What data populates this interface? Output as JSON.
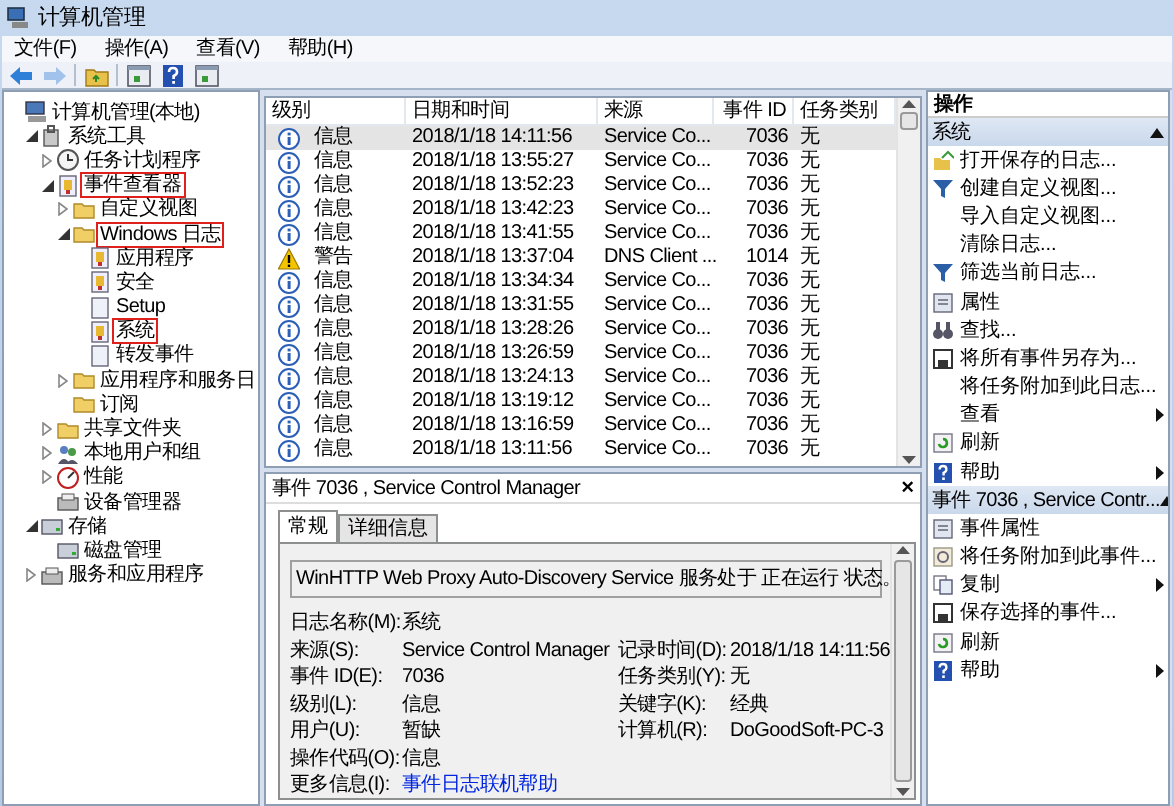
{
  "window": {
    "title": "计算机管理"
  },
  "menu": [
    "文件(F)",
    "操作(A)",
    "查看(V)",
    "帮助(H)"
  ],
  "toolbar": [
    {
      "kind": "back",
      "disabled": false
    },
    {
      "kind": "forward",
      "disabled": true
    },
    {
      "kind": "up",
      "disabled": false
    },
    {
      "kind": "panel",
      "disabled": false
    },
    {
      "kind": "help",
      "disabled": false
    },
    {
      "kind": "panel",
      "disabled": false
    }
  ],
  "tree": [
    {
      "label": "计算机管理(本地)",
      "kind": "computer",
      "children": [
        {
          "label": "系统工具",
          "kind": "tools",
          "expanded": true,
          "children": [
            {
              "label": "任务计划程序",
              "kind": "clock",
              "expanded": false
            },
            {
              "label": "事件查看器",
              "kind": "log",
              "expanded": true,
              "marked": true,
              "children": [
                {
                  "label": "自定义视图",
                  "kind": "folder",
                  "expanded": false
                },
                {
                  "label": "Windows 日志",
                  "kind": "folder",
                  "expanded": true,
                  "marked": true,
                  "children": [
                    {
                      "label": "应用程序",
                      "kind": "log"
                    },
                    {
                      "label": "安全",
                      "kind": "log"
                    },
                    {
                      "label": "Setup",
                      "kind": "page"
                    },
                    {
                      "label": "系统",
                      "kind": "log",
                      "marked": true
                    },
                    {
                      "label": "转发事件",
                      "kind": "page"
                    }
                  ]
                },
                {
                  "label": "应用程序和服务日",
                  "kind": "folder",
                  "expanded": false
                },
                {
                  "label": "订阅",
                  "kind": "folder"
                }
              ]
            },
            {
              "label": "共享文件夹",
              "kind": "folder",
              "expanded": false
            },
            {
              "label": "本地用户和组",
              "kind": "users",
              "expanded": false
            },
            {
              "label": "性能",
              "kind": "gauge",
              "expanded": false
            },
            {
              "label": "设备管理器",
              "kind": "device"
            }
          ]
        },
        {
          "label": "存储",
          "kind": "drive",
          "expanded": true,
          "children": [
            {
              "label": "磁盘管理",
              "kind": "drive"
            }
          ]
        },
        {
          "label": "服务和应用程序",
          "kind": "device",
          "expanded": false
        }
      ]
    }
  ],
  "table": {
    "columns": [
      "级别",
      "日期和时间",
      "来源",
      "事件 ID",
      "任务类别"
    ],
    "rows": [
      {
        "kind": "info",
        "level": "信息",
        "date": "2018/1/18 14:11:56",
        "source": "Service Co...",
        "id": "7036",
        "category": "无",
        "selected": true
      },
      {
        "kind": "info",
        "level": "信息",
        "date": "2018/1/18 13:55:27",
        "source": "Service Co...",
        "id": "7036",
        "category": "无",
        "selected": false
      },
      {
        "kind": "info",
        "level": "信息",
        "date": "2018/1/18 13:52:23",
        "source": "Service Co...",
        "id": "7036",
        "category": "无",
        "selected": false
      },
      {
        "kind": "info",
        "level": "信息",
        "date": "2018/1/18 13:42:23",
        "source": "Service Co...",
        "id": "7036",
        "category": "无",
        "selected": false
      },
      {
        "kind": "info",
        "level": "信息",
        "date": "2018/1/18 13:41:55",
        "source": "Service Co...",
        "id": "7036",
        "category": "无",
        "selected": false
      },
      {
        "kind": "warning",
        "level": "警告",
        "date": "2018/1/18 13:37:04",
        "source": "DNS Client ...",
        "id": "1014",
        "category": "无",
        "selected": false
      },
      {
        "kind": "info",
        "level": "信息",
        "date": "2018/1/18 13:34:34",
        "source": "Service Co...",
        "id": "7036",
        "category": "无",
        "selected": false
      },
      {
        "kind": "info",
        "level": "信息",
        "date": "2018/1/18 13:31:55",
        "source": "Service Co...",
        "id": "7036",
        "category": "无",
        "selected": false
      },
      {
        "kind": "info",
        "level": "信息",
        "date": "2018/1/18 13:28:26",
        "source": "Service Co...",
        "id": "7036",
        "category": "无",
        "selected": false
      },
      {
        "kind": "info",
        "level": "信息",
        "date": "2018/1/18 13:26:59",
        "source": "Service Co...",
        "id": "7036",
        "category": "无",
        "selected": false
      },
      {
        "kind": "info",
        "level": "信息",
        "date": "2018/1/18 13:24:13",
        "source": "Service Co...",
        "id": "7036",
        "category": "无",
        "selected": false
      },
      {
        "kind": "info",
        "level": "信息",
        "date": "2018/1/18 13:19:12",
        "source": "Service Co...",
        "id": "7036",
        "category": "无",
        "selected": false
      },
      {
        "kind": "info",
        "level": "信息",
        "date": "2018/1/18 13:16:59",
        "source": "Service Co...",
        "id": "7036",
        "category": "无",
        "selected": false
      },
      {
        "kind": "info",
        "level": "信息",
        "date": "2018/1/18 13:11:56",
        "source": "Service Co...",
        "id": "7036",
        "category": "无",
        "selected": false
      }
    ]
  },
  "detail": {
    "title": "事件 7036 , Service Control Manager",
    "close": "×",
    "tabs": [
      {
        "label": "常规",
        "selected": true
      },
      {
        "label": "详细信息",
        "selected": false
      }
    ],
    "message": "WinHTTP Web Proxy Auto-Discovery Service 服务处于 正在运行 状态。",
    "fields": [
      {
        "label": "日志名称(M):",
        "value": "系统"
      },
      {
        "label": "来源(S):",
        "value": "Service Control Manager",
        "label2": "记录时间(D):",
        "value2": "2018/1/18 14:11:56"
      },
      {
        "label": "事件 ID(E):",
        "value": "7036",
        "label2": "任务类别(Y):",
        "value2": "无"
      },
      {
        "label": "级别(L):",
        "value": "信息",
        "label2": "关键字(K):",
        "value2": "经典"
      },
      {
        "label": "用户(U):",
        "value": "暂缺",
        "label2": "计算机(R):",
        "value2": "DoGoodSoft-PC-3"
      },
      {
        "label": "操作代码(O):",
        "value": "信息"
      },
      {
        "label": "更多信息(I):",
        "value": "事件日志联机帮助",
        "kind": "link"
      }
    ]
  },
  "actions": {
    "title": "操作",
    "sections": [
      {
        "title": "系统",
        "expanded": true,
        "items": [
          {
            "label": "打开保存的日志...",
            "kind": "open"
          },
          {
            "label": "创建自定义视图...",
            "kind": "filter"
          },
          {
            "label": "导入自定义视图..."
          },
          {
            "label": "清除日志..."
          },
          {
            "label": "筛选当前日志...",
            "kind": "filter"
          },
          {
            "label": "属性",
            "kind": "props"
          },
          {
            "label": "查找...",
            "kind": "find"
          },
          {
            "label": "将所有事件另存为...",
            "kind": "save"
          },
          {
            "label": "将任务附加到此日志..."
          },
          {
            "label": "查看",
            "submenu": true
          },
          {
            "label": "刷新",
            "kind": "refresh"
          },
          {
            "label": "帮助",
            "kind": "help",
            "submenu": true
          }
        ]
      },
      {
        "title": "事件 7036 , Service Contr...",
        "expanded": true,
        "items": [
          {
            "label": "事件属性",
            "kind": "props"
          },
          {
            "label": "将任务附加到此事件...",
            "kind": "task"
          },
          {
            "label": "复制",
            "kind": "copy",
            "submenu": true
          },
          {
            "label": "保存选择的事件...",
            "kind": "save"
          },
          {
            "label": "刷新",
            "kind": "refresh"
          },
          {
            "label": "帮助",
            "kind": "help",
            "submenu": true
          }
        ]
      }
    ]
  }
}
